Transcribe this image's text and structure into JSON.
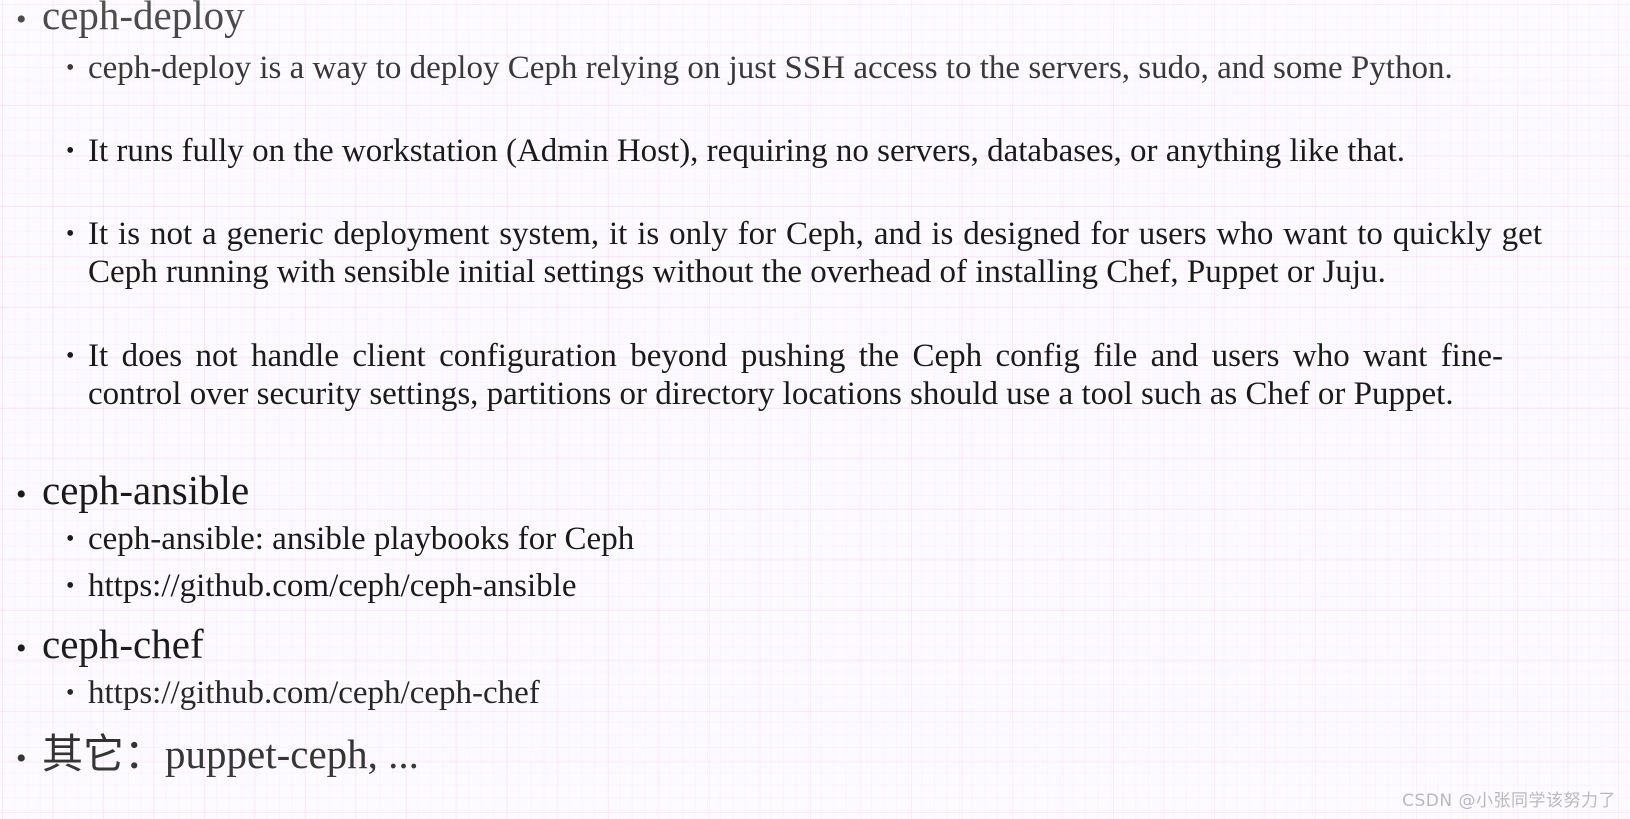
{
  "slide": {
    "background_color": "#fdfaff",
    "grid_color": "#ecc8ec",
    "text_color": "#1a1a1a",
    "bullet_glyph": "•"
  },
  "outline": [
    {
      "level": 1,
      "text": "ceph-deploy"
    },
    {
      "level": 2,
      "text": "ceph-deploy is a way to deploy Ceph relying on just SSH access to the servers, sudo, and some Python."
    },
    {
      "level": 2,
      "text": "It runs fully on the workstation (Admin Host), requiring no servers, databases, or anything like that."
    },
    {
      "level": 2,
      "text": "It is not a generic deployment system, it is only for Ceph, and is designed for users who want to quickly get Ceph running with sensible initial settings without the overhead of installing Chef, Puppet or Juju."
    },
    {
      "level": 2,
      "text": "It does not handle client configuration beyond pushing the Ceph config file and users who want fine-control over security settings, partitions or directory locations should use a tool such as Chef or Puppet."
    },
    {
      "level": 1,
      "text": "ceph-ansible"
    },
    {
      "level": 2,
      "text": "ceph-ansible: ansible playbooks for Ceph"
    },
    {
      "level": 2,
      "text": "https://github.com/ceph/ceph-ansible"
    },
    {
      "level": 1,
      "text": "ceph-chef"
    },
    {
      "level": 2,
      "text": "https://github.com/ceph/ceph-chef"
    },
    {
      "level": 1,
      "text": "其它：puppet-ceph, ..."
    }
  ],
  "watermark": {
    "text": "CSDN @小张同学该努力了"
  }
}
